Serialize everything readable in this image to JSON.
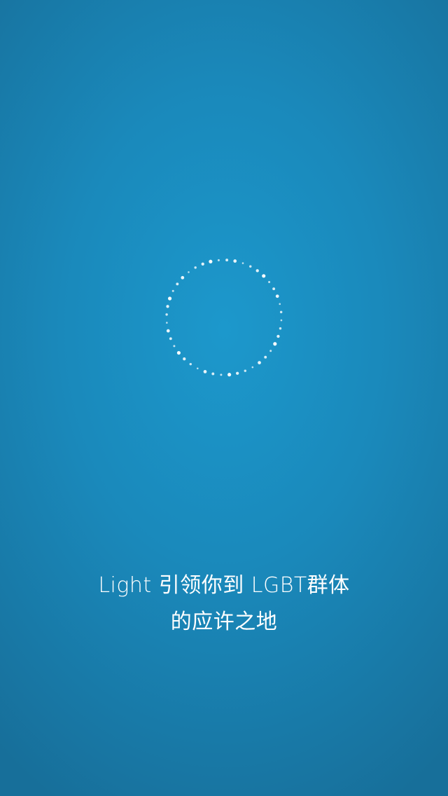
{
  "splash": {
    "tagline_line1": "Light 引领你到 LGBT群体",
    "tagline_line2": "的应许之地"
  },
  "colors": {
    "background_center": "#1c98cc",
    "background_edge": "#176f9a",
    "text": "#ffffff",
    "ring_dots": "#ffffff"
  },
  "icons": {
    "loader": "dotted-circle-loader-icon"
  }
}
